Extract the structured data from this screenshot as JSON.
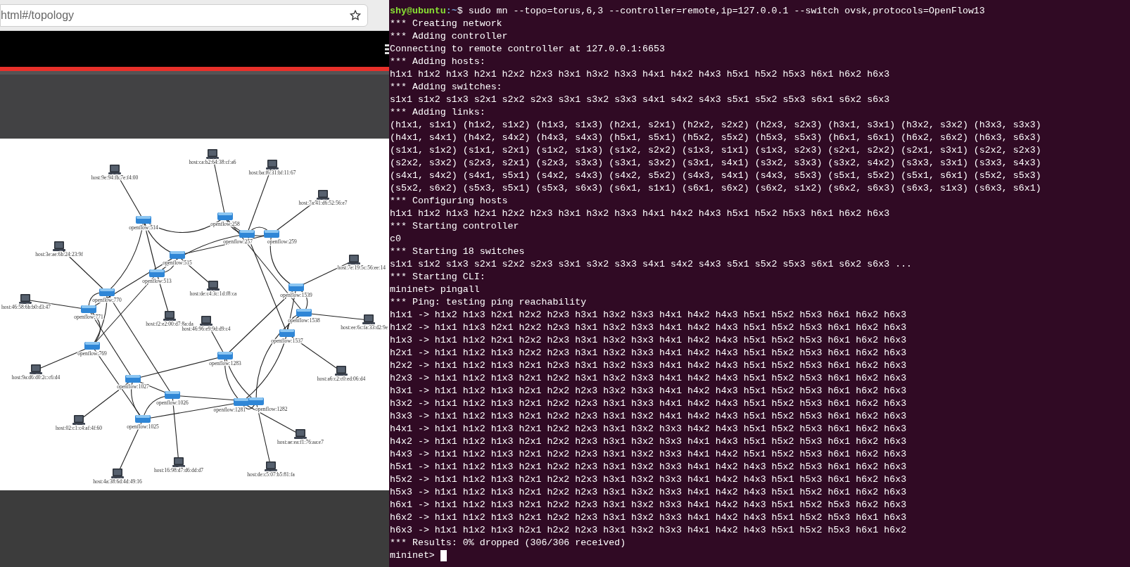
{
  "browser": {
    "address_bar": {
      "url": "html#/topology"
    },
    "topology": {
      "nodes": [
        {
          "kind": "switch",
          "label": "openflow:514"
        },
        {
          "kind": "switch",
          "label": "openflow:515"
        },
        {
          "kind": "switch",
          "label": "openflow:513"
        },
        {
          "kind": "switch",
          "label": "openflow:258"
        },
        {
          "kind": "switch",
          "label": "openflow:257"
        },
        {
          "kind": "switch",
          "label": "openflow:259"
        },
        {
          "kind": "switch",
          "label": "openflow:770"
        },
        {
          "kind": "switch",
          "label": "openflow:771"
        },
        {
          "kind": "switch",
          "label": "openflow:769"
        },
        {
          "kind": "switch",
          "label": "openflow:1539"
        },
        {
          "kind": "switch",
          "label": "openflow:1538"
        },
        {
          "kind": "switch",
          "label": "openflow:1537"
        },
        {
          "kind": "switch",
          "label": "openflow:1283"
        },
        {
          "kind": "switch",
          "label": "openflow:1281"
        },
        {
          "kind": "switch",
          "label": "openflow:1282"
        },
        {
          "kind": "switch",
          "label": "openflow:1027"
        },
        {
          "kind": "switch",
          "label": "openflow:1026"
        },
        {
          "kind": "switch",
          "label": "openflow:1025"
        },
        {
          "kind": "host",
          "label": "host:9e:94:fb:7e:f4:00"
        },
        {
          "kind": "host",
          "label": "host:3e:ae:6b:24:23:9f"
        },
        {
          "kind": "host",
          "label": "host:46:58:6b:b0:d3:47"
        },
        {
          "kind": "host",
          "label": "host:f2:e2:00:d7:8a:da"
        },
        {
          "kind": "host",
          "label": "host:ca:b2:64:38:cf:a6"
        },
        {
          "kind": "host",
          "label": "host:ba:f6:31:bf:11:67"
        },
        {
          "kind": "host",
          "label": "host:7a:41:d6:52:56:e7"
        },
        {
          "kind": "host",
          "label": "host:7e:19:5c:56:ee:14"
        },
        {
          "kind": "host",
          "label": "host:de:c4:3c:1d:f8:ca"
        },
        {
          "kind": "host",
          "label": "host:46:96:e9:9d:d9:c4"
        },
        {
          "kind": "host",
          "label": "host:ee:6c:fa:33:d2:9e"
        },
        {
          "kind": "host",
          "label": "host:9a:d6:d0:2c:c6:d4"
        },
        {
          "kind": "host",
          "label": "host:02:c1:c4:af:4f:60"
        },
        {
          "kind": "host",
          "label": "host:16:98:d7:d6:dd:d7"
        },
        {
          "kind": "host",
          "label": "host:4a:38:6d:4d:49:16"
        },
        {
          "kind": "host",
          "label": "host:a6:c2:c0:ed:06:d4"
        },
        {
          "kind": "host",
          "label": "host:ae:ea:f1:76:aa:e7"
        },
        {
          "kind": "host",
          "label": "host:de:c5:07:b5:81:fa"
        }
      ]
    }
  },
  "terminal": {
    "prompt": {
      "user_host": "shy@ubuntu",
      "path": ":~",
      "command": "$ sudo mn --topo=torus,6,3 --controller=remote,ip=127.0.0.1 --switch ovsk,protocols=OpenFlow13"
    },
    "lines": [
      "*** Creating network",
      "*** Adding controller",
      "Connecting to remote controller at 127.0.0.1:6653",
      "*** Adding hosts:",
      "h1x1 h1x2 h1x3 h2x1 h2x2 h2x3 h3x1 h3x2 h3x3 h4x1 h4x2 h4x3 h5x1 h5x2 h5x3 h6x1 h6x2 h6x3",
      "*** Adding switches:",
      "s1x1 s1x2 s1x3 s2x1 s2x2 s2x3 s3x1 s3x2 s3x3 s4x1 s4x2 s4x3 s5x1 s5x2 s5x3 s6x1 s6x2 s6x3",
      "*** Adding links:",
      "(h1x1, s1x1) (h1x2, s1x2) (h1x3, s1x3) (h2x1, s2x1) (h2x2, s2x2) (h2x3, s2x3) (h3x1, s3x1) (h3x2, s3x2) (h3x3, s3x3)",
      "(h4x1, s4x1) (h4x2, s4x2) (h4x3, s4x3) (h5x1, s5x1) (h5x2, s5x2) (h5x3, s5x3) (h6x1, s6x1) (h6x2, s6x2) (h6x3, s6x3)",
      "(s1x1, s1x2) (s1x1, s2x1) (s1x2, s1x3) (s1x2, s2x2) (s1x3, s1x1) (s1x3, s2x3) (s2x1, s2x2) (s2x1, s3x1) (s2x2, s2x3)",
      "(s2x2, s3x2) (s2x3, s2x1) (s2x3, s3x3) (s3x1, s3x2) (s3x1, s4x1) (s3x2, s3x3) (s3x2, s4x2) (s3x3, s3x1) (s3x3, s4x3)",
      "(s4x1, s4x2) (s4x1, s5x1) (s4x2, s4x3) (s4x2, s5x2) (s4x3, s4x1) (s4x3, s5x3) (s5x1, s5x2) (s5x1, s6x1) (s5x2, s5x3)",
      "(s5x2, s6x2) (s5x3, s5x1) (s5x3, s6x3) (s6x1, s1x1) (s6x1, s6x2) (s6x2, s1x2) (s6x2, s6x3) (s6x3, s1x3) (s6x3, s6x1)",
      "*** Configuring hosts",
      "h1x1 h1x2 h1x3 h2x1 h2x2 h2x3 h3x1 h3x2 h3x3 h4x1 h4x2 h4x3 h5x1 h5x2 h5x3 h6x1 h6x2 h6x3",
      "*** Starting controller",
      "c0",
      "*** Starting 18 switches",
      "s1x1 s1x2 s1x3 s2x1 s2x2 s2x3 s3x1 s3x2 s3x3 s4x1 s4x2 s4x3 s5x1 s5x2 s5x3 s6x1 s6x2 s6x3 ...",
      "*** Starting CLI:",
      "mininet> pingall",
      "*** Ping: testing ping reachability",
      "h1x1 -> h1x2 h1x3 h2x1 h2x2 h2x3 h3x1 h3x2 h3x3 h4x1 h4x2 h4x3 h5x1 h5x2 h5x3 h6x1 h6x2 h6x3",
      "h1x2 -> h1x1 h1x3 h2x1 h2x2 h2x3 h3x1 h3x2 h3x3 h4x1 h4x2 h4x3 h5x1 h5x2 h5x3 h6x1 h6x2 h6x3",
      "h1x3 -> h1x1 h1x2 h2x1 h2x2 h2x3 h3x1 h3x2 h3x3 h4x1 h4x2 h4x3 h5x1 h5x2 h5x3 h6x1 h6x2 h6x3",
      "h2x1 -> h1x1 h1x2 h1x3 h2x2 h2x3 h3x1 h3x2 h3x3 h4x1 h4x2 h4x3 h5x1 h5x2 h5x3 h6x1 h6x2 h6x3",
      "h2x2 -> h1x1 h1x2 h1x3 h2x1 h2x3 h3x1 h3x2 h3x3 h4x1 h4x2 h4x3 h5x1 h5x2 h5x3 h6x1 h6x2 h6x3",
      "h2x3 -> h1x1 h1x2 h1x3 h2x1 h2x2 h3x1 h3x2 h3x3 h4x1 h4x2 h4x3 h5x1 h5x2 h5x3 h6x1 h6x2 h6x3",
      "h3x1 -> h1x1 h1x2 h1x3 h2x1 h2x2 h2x3 h3x2 h3x3 h4x1 h4x2 h4x3 h5x1 h5x2 h5x3 h6x1 h6x2 h6x3",
      "h3x2 -> h1x1 h1x2 h1x3 h2x1 h2x2 h2x3 h3x1 h3x3 h4x1 h4x2 h4x3 h5x1 h5x2 h5x3 h6x1 h6x2 h6x3",
      "h3x3 -> h1x1 h1x2 h1x3 h2x1 h2x2 h2x3 h3x1 h3x2 h4x1 h4x2 h4x3 h5x1 h5x2 h5x3 h6x1 h6x2 h6x3",
      "h4x1 -> h1x1 h1x2 h1x3 h2x1 h2x2 h2x3 h3x1 h3x2 h3x3 h4x2 h4x3 h5x1 h5x2 h5x3 h6x1 h6x2 h6x3",
      "h4x2 -> h1x1 h1x2 h1x3 h2x1 h2x2 h2x3 h3x1 h3x2 h3x3 h4x1 h4x3 h5x1 h5x2 h5x3 h6x1 h6x2 h6x3",
      "h4x3 -> h1x1 h1x2 h1x3 h2x1 h2x2 h2x3 h3x1 h3x2 h3x3 h4x1 h4x2 h5x1 h5x2 h5x3 h6x1 h6x2 h6x3",
      "h5x1 -> h1x1 h1x2 h1x3 h2x1 h2x2 h2x3 h3x1 h3x2 h3x3 h4x1 h4x2 h4x3 h5x2 h5x3 h6x1 h6x2 h6x3",
      "h5x2 -> h1x1 h1x2 h1x3 h2x1 h2x2 h2x3 h3x1 h3x2 h3x3 h4x1 h4x2 h4x3 h5x1 h5x3 h6x1 h6x2 h6x3",
      "h5x3 -> h1x1 h1x2 h1x3 h2x1 h2x2 h2x3 h3x1 h3x2 h3x3 h4x1 h4x2 h4x3 h5x1 h5x2 h6x1 h6x2 h6x3",
      "h6x1 -> h1x1 h1x2 h1x3 h2x1 h2x2 h2x3 h3x1 h3x2 h3x3 h4x1 h4x2 h4x3 h5x1 h5x2 h5x3 h6x2 h6x3",
      "h6x2 -> h1x1 h1x2 h1x3 h2x1 h2x2 h2x3 h3x1 h3x2 h3x3 h4x1 h4x2 h4x3 h5x1 h5x2 h5x3 h6x1 h6x3",
      "h6x3 -> h1x1 h1x2 h1x3 h2x1 h2x2 h2x3 h3x1 h3x2 h3x3 h4x1 h4x2 h4x3 h5x1 h5x2 h5x3 h6x1 h6x2",
      "*** Results: 0% dropped (306/306 received)"
    ],
    "input_prompt": "mininet>"
  }
}
